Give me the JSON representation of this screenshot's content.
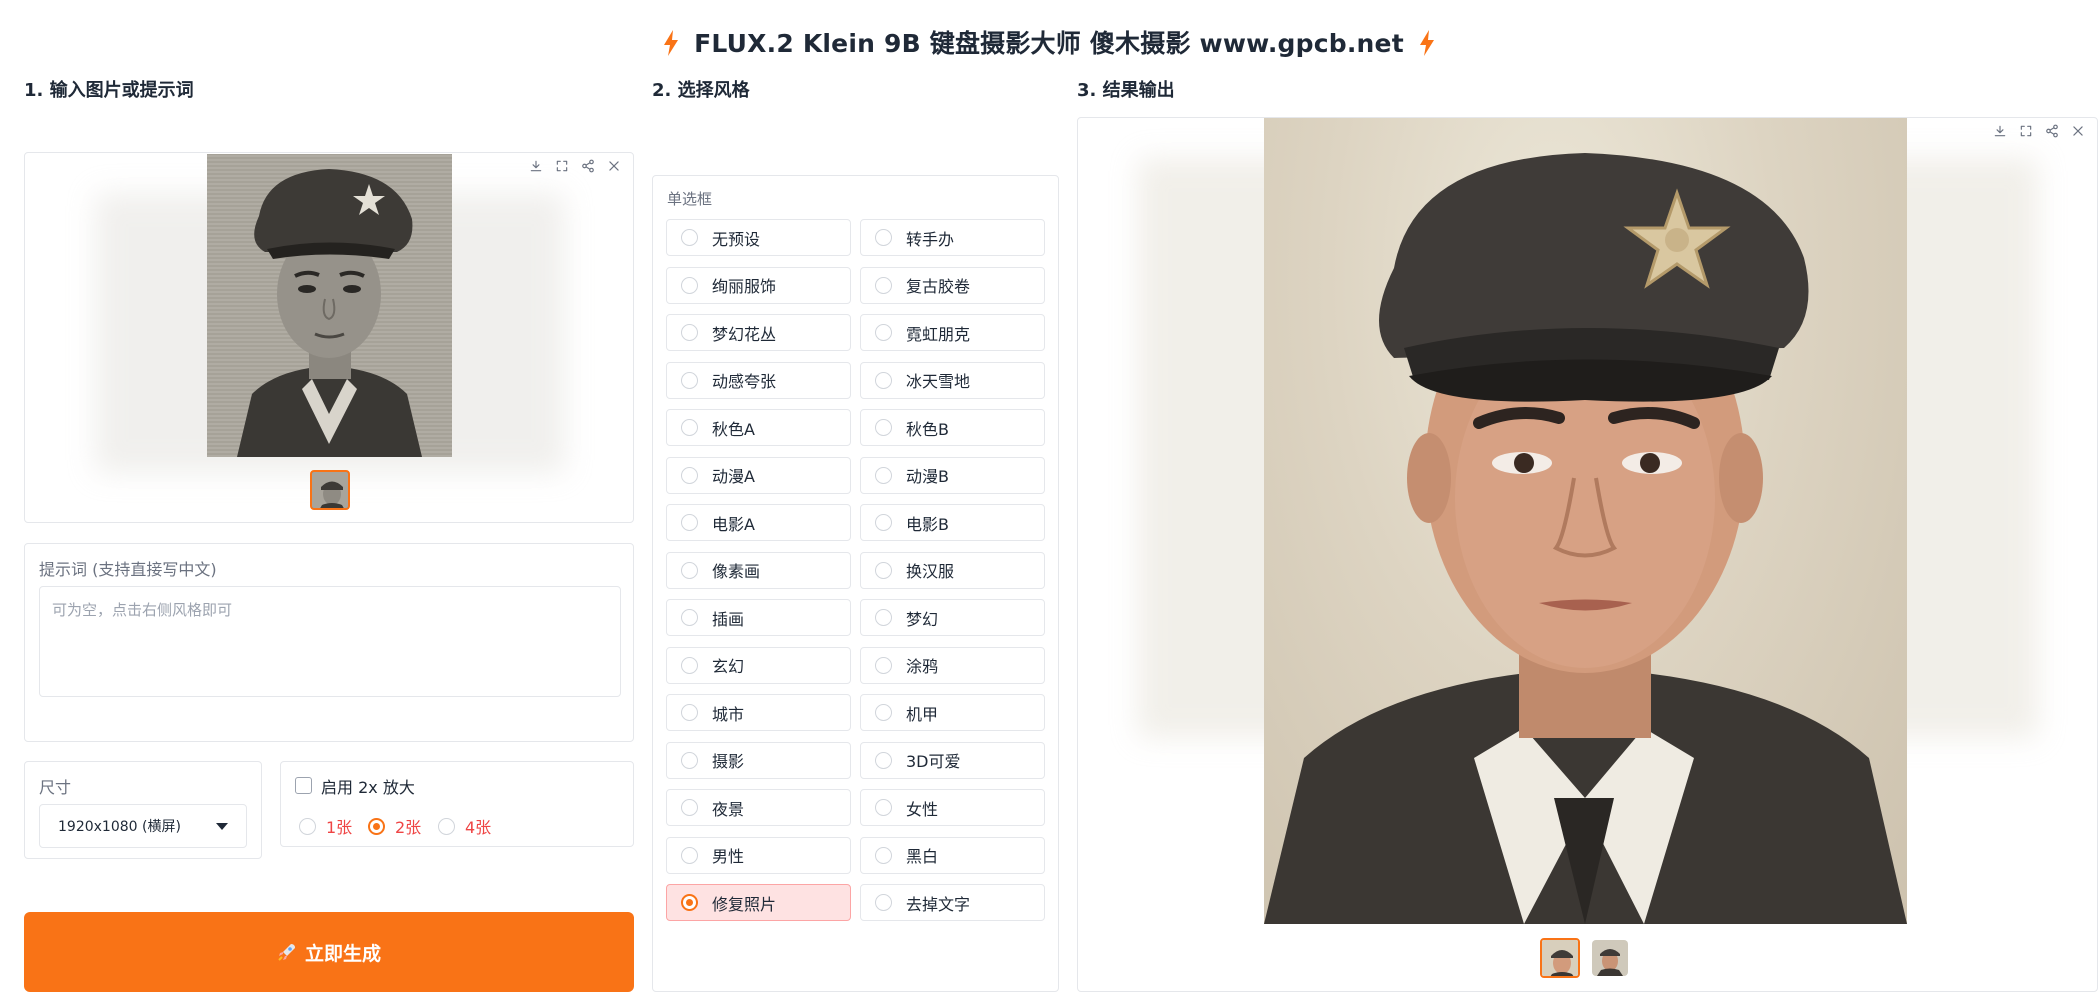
{
  "header": {
    "title": "FLUX.2 Klein 9B 键盘摄影大师 傻木摄影 www.gpcb.net"
  },
  "section1": {
    "label": "1. 输入图片或提示词"
  },
  "section2": {
    "label": "2. 选择风格",
    "radio_group_label": "单选框",
    "styles": [
      "无预设",
      "转手办",
      "绚丽服饰",
      "复古胶卷",
      "梦幻花丛",
      "霓虹朋克",
      "动感夸张",
      "冰天雪地",
      "秋色A",
      "秋色B",
      "动漫A",
      "动漫B",
      "电影A",
      "电影B",
      "像素画",
      "换汉服",
      "插画",
      "梦幻",
      "玄幻",
      "涂鸦",
      "城市",
      "机甲",
      "摄影",
      "3D可爱",
      "夜景",
      "女性",
      "男性",
      "黑白",
      "修复照片",
      "去掉文字"
    ],
    "selected_style": "修复照片"
  },
  "section3": {
    "label": "3. 结果输出"
  },
  "prompt": {
    "label": "提示词 (支持直接写中文)",
    "placeholder": "可为空，点击右侧风格即可"
  },
  "size": {
    "label": "尺寸",
    "value": "1920x1080 (横屏)"
  },
  "upscale": {
    "label": "启用 2x 放大",
    "checked": false
  },
  "count": {
    "options": [
      "1张",
      "2张",
      "4张"
    ],
    "selected": "2张"
  },
  "generate_button": {
    "label": "立即生成"
  },
  "colors": {
    "accent": "#f97316",
    "selected_bg": "#fee2e2",
    "count_text": "#ef4444"
  },
  "icons": {
    "toolbar": [
      "download-icon",
      "fullscreen-icon",
      "share-icon",
      "close-icon"
    ],
    "title": "lightning-icon",
    "button": "rocket-icon"
  }
}
